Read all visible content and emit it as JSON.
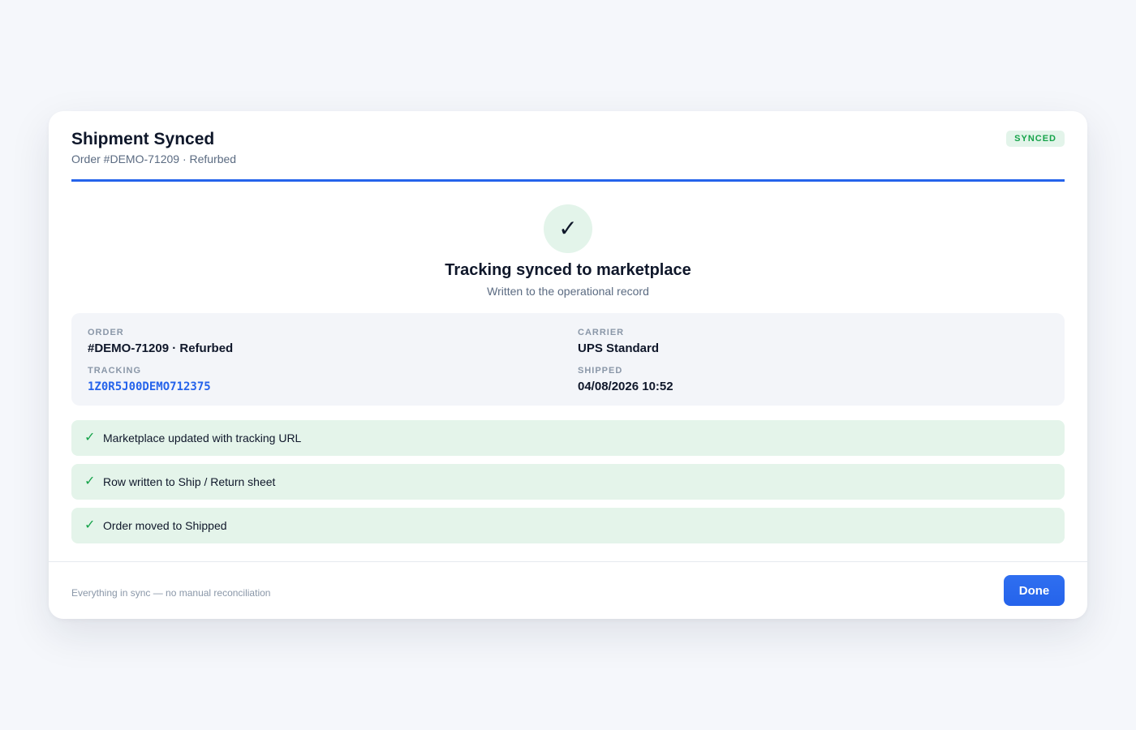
{
  "dialog": {
    "title": "Shipment Synced",
    "subtitle": "Order #DEMO-71209 · Refurbed",
    "badge": "SYNCED"
  },
  "hero": {
    "icon": "check-icon",
    "icon_glyph": "✓",
    "title": "Tracking synced to marketplace",
    "subtitle": "Written to the operational record"
  },
  "details": {
    "order": {
      "label": "ORDER",
      "value": "#DEMO-71209 · Refurbed"
    },
    "carrier": {
      "label": "CARRIER",
      "value": "UPS Standard"
    },
    "tracking": {
      "label": "TRACKING",
      "value": "1Z0R5J00DEMO712375"
    },
    "shipped": {
      "label": "SHIPPED",
      "value": "04/08/2026 10:52"
    }
  },
  "steps": [
    {
      "icon": "check-icon",
      "glyph": "✓",
      "text": "Marketplace updated with tracking URL"
    },
    {
      "icon": "check-icon",
      "glyph": "✓",
      "text": "Row written to Ship / Return sheet"
    },
    {
      "icon": "check-icon",
      "glyph": "✓",
      "text": "Order moved to Shipped"
    }
  ],
  "footer": {
    "note": "Everything in sync — no manual reconciliation",
    "done_label": "Done"
  },
  "colors": {
    "accent": "#2563eb",
    "success": "#16a34a",
    "success_bg": "#e4f4ea"
  }
}
